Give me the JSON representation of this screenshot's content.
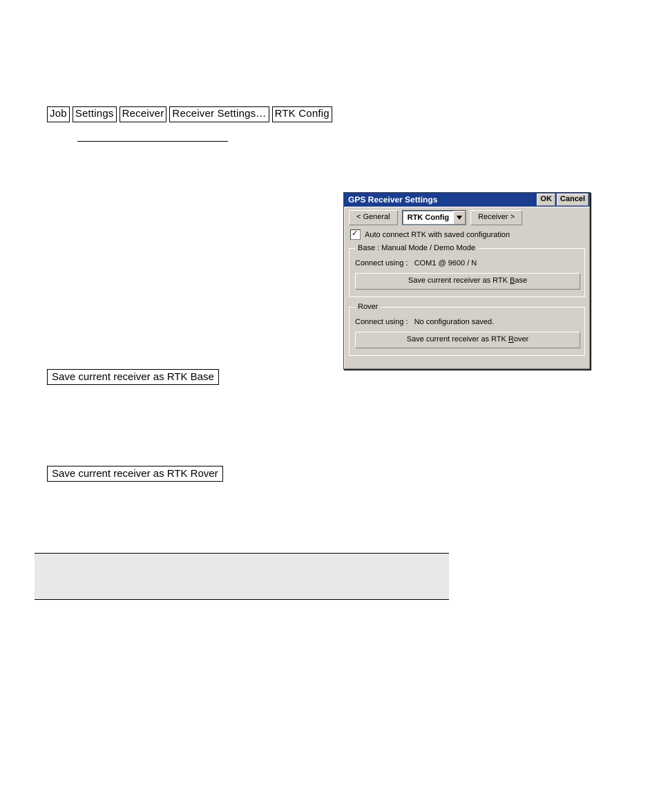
{
  "breadcrumb": {
    "items": [
      "Job",
      "Settings",
      "Receiver",
      "Receiver Settings…",
      "RTK Config"
    ]
  },
  "body_buttons": {
    "save_base": "Save current receiver as RTK Base",
    "save_rover": "Save current receiver as RTK Rover"
  },
  "dialog": {
    "title": "GPS Receiver Settings",
    "ok": "OK",
    "cancel": "Cancel",
    "tabs": {
      "prev": "< General",
      "current": "RTK Config",
      "next": "Receiver >"
    },
    "auto_connect_label": "Auto connect RTK with saved  configuration",
    "auto_connect_checked": true,
    "base": {
      "legend": "Base :  Manual Mode / Demo Mode",
      "connect_label": "Connect using :",
      "connect_value": "COM1  @ 9600 / N",
      "button_pre": "Save current receiver as RTK ",
      "button_u": "B",
      "button_post": "ase"
    },
    "rover": {
      "legend": "Rover",
      "connect_label": "Connect using :",
      "connect_value": "No configuration saved.",
      "button_pre": "Save current receiver as RTK ",
      "button_u": "R",
      "button_post": "over"
    }
  }
}
